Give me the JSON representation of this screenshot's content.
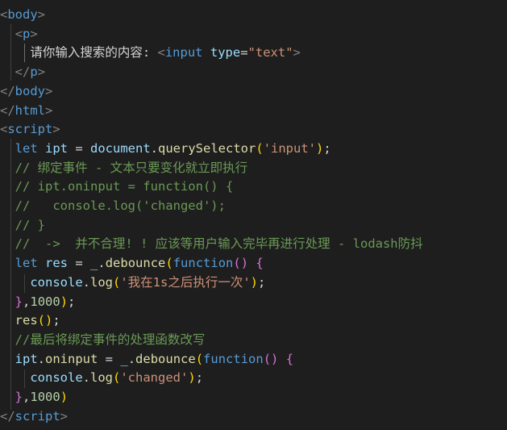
{
  "theme": {
    "background": "#1e1e1e",
    "colors": {
      "tag": "#569cd6",
      "bracket": "#808080",
      "attr": "#9cdcfe",
      "string": "#ce9178",
      "keyword": "#569cd6",
      "variable": "#9cdcfe",
      "function": "#dcdcaa",
      "comment": "#6a9955",
      "text": "#d4d4d4",
      "number": "#b5cea8",
      "brace_gold": "#ffd700",
      "brace_purple": "#da70d6"
    }
  },
  "lines": [
    [
      {
        "t": "<",
        "c": "bracket"
      },
      {
        "t": "body",
        "c": "tag"
      },
      {
        "t": ">",
        "c": "bracket"
      }
    ],
    [
      {
        "t": "  "
      },
      {
        "t": "<",
        "c": "bracket"
      },
      {
        "t": "p",
        "c": "tag"
      },
      {
        "t": ">",
        "c": "bracket"
      }
    ],
    [
      {
        "t": "    请你输入搜索的内容: ",
        "c": "text"
      },
      {
        "t": "<",
        "c": "bracket"
      },
      {
        "t": "input",
        "c": "tag"
      },
      {
        "t": " "
      },
      {
        "t": "type",
        "c": "attr"
      },
      {
        "t": "=",
        "c": "text"
      },
      {
        "t": "\"text\"",
        "c": "string"
      },
      {
        "t": ">",
        "c": "bracket"
      }
    ],
    [
      {
        "t": "  "
      },
      {
        "t": "</",
        "c": "bracket"
      },
      {
        "t": "p",
        "c": "tag"
      },
      {
        "t": ">",
        "c": "bracket"
      }
    ],
    [
      {
        "t": "</",
        "c": "bracket"
      },
      {
        "t": "body",
        "c": "tag"
      },
      {
        "t": ">",
        "c": "bracket"
      }
    ],
    [
      {
        "t": "</",
        "c": "bracket"
      },
      {
        "t": "html",
        "c": "tag"
      },
      {
        "t": ">",
        "c": "bracket"
      }
    ],
    [
      {
        "t": "<",
        "c": "bracket"
      },
      {
        "t": "script",
        "c": "tag"
      },
      {
        "t": ">",
        "c": "bracket"
      }
    ],
    [
      {
        "t": "  "
      },
      {
        "t": "let",
        "c": "keyword"
      },
      {
        "t": " "
      },
      {
        "t": "ipt",
        "c": "variable"
      },
      {
        "t": " = ",
        "c": "text"
      },
      {
        "t": "document",
        "c": "variable"
      },
      {
        "t": ".",
        "c": "text"
      },
      {
        "t": "querySelector",
        "c": "function"
      },
      {
        "t": "(",
        "c": "brace_gold"
      },
      {
        "t": "'input'",
        "c": "string"
      },
      {
        "t": ")",
        "c": "brace_gold"
      },
      {
        "t": ";",
        "c": "text"
      }
    ],
    [
      {
        "t": "  "
      },
      {
        "t": "// 绑定事件 - 文本只要变化就立即执行",
        "c": "comment"
      }
    ],
    [
      {
        "t": "  "
      },
      {
        "t": "// ipt.oninput = function() {",
        "c": "comment"
      }
    ],
    [
      {
        "t": "  "
      },
      {
        "t": "//   console.log('changed');",
        "c": "comment"
      }
    ],
    [
      {
        "t": "  "
      },
      {
        "t": "// }",
        "c": "comment"
      }
    ],
    [
      {
        "t": "  "
      },
      {
        "t": "//  ->  并不合理! ! 应该等用户输入完毕再进行处理 - lodash防抖",
        "c": "comment"
      }
    ],
    [
      {
        "t": "  "
      },
      {
        "t": "let",
        "c": "keyword"
      },
      {
        "t": " "
      },
      {
        "t": "res",
        "c": "variable"
      },
      {
        "t": " = ",
        "c": "text"
      },
      {
        "t": "_",
        "c": "variable"
      },
      {
        "t": ".",
        "c": "text"
      },
      {
        "t": "debounce",
        "c": "function"
      },
      {
        "t": "(",
        "c": "brace_gold"
      },
      {
        "t": "function",
        "c": "keyword"
      },
      {
        "t": "()",
        "c": "brace_purple"
      },
      {
        "t": " "
      },
      {
        "t": "{",
        "c": "brace_purple"
      }
    ],
    [
      {
        "t": "    "
      },
      {
        "t": "console",
        "c": "variable"
      },
      {
        "t": ".",
        "c": "text"
      },
      {
        "t": "log",
        "c": "function"
      },
      {
        "t": "(",
        "c": "brace_gold"
      },
      {
        "t": "'我在1s之后执行一次'",
        "c": "string"
      },
      {
        "t": ")",
        "c": "brace_gold"
      },
      {
        "t": ";",
        "c": "text"
      }
    ],
    [
      {
        "t": "  "
      },
      {
        "t": "}",
        "c": "brace_purple"
      },
      {
        "t": ",",
        "c": "text"
      },
      {
        "t": "1000",
        "c": "number"
      },
      {
        "t": ")",
        "c": "brace_gold"
      },
      {
        "t": ";",
        "c": "text"
      }
    ],
    [
      {
        "t": "  "
      },
      {
        "t": "res",
        "c": "function"
      },
      {
        "t": "()",
        "c": "brace_gold"
      },
      {
        "t": ";",
        "c": "text"
      }
    ],
    [
      {
        "t": "  "
      },
      {
        "t": "//最后将绑定事件的处理函数改写",
        "c": "comment"
      }
    ],
    [
      {
        "t": "  "
      },
      {
        "t": "ipt",
        "c": "variable"
      },
      {
        "t": ".",
        "c": "text"
      },
      {
        "t": "oninput",
        "c": "function"
      },
      {
        "t": " = ",
        "c": "text"
      },
      {
        "t": "_",
        "c": "variable"
      },
      {
        "t": ".",
        "c": "text"
      },
      {
        "t": "debounce",
        "c": "function"
      },
      {
        "t": "(",
        "c": "brace_gold"
      },
      {
        "t": "function",
        "c": "keyword"
      },
      {
        "t": "()",
        "c": "brace_purple"
      },
      {
        "t": " "
      },
      {
        "t": "{",
        "c": "brace_purple"
      }
    ],
    [
      {
        "t": "    "
      },
      {
        "t": "console",
        "c": "variable"
      },
      {
        "t": ".",
        "c": "text"
      },
      {
        "t": "log",
        "c": "function"
      },
      {
        "t": "(",
        "c": "brace_gold"
      },
      {
        "t": "'changed'",
        "c": "string"
      },
      {
        "t": ")",
        "c": "brace_gold"
      },
      {
        "t": ";",
        "c": "text"
      }
    ],
    [
      {
        "t": "  "
      },
      {
        "t": "}",
        "c": "brace_purple"
      },
      {
        "t": ",",
        "c": "text"
      },
      {
        "t": "1000",
        "c": "number"
      },
      {
        "t": ")",
        "c": "brace_gold"
      }
    ],
    [
      {
        "t": "</",
        "c": "bracket"
      },
      {
        "t": "script",
        "c": "tag"
      },
      {
        "t": ">",
        "c": "bracket"
      }
    ]
  ]
}
